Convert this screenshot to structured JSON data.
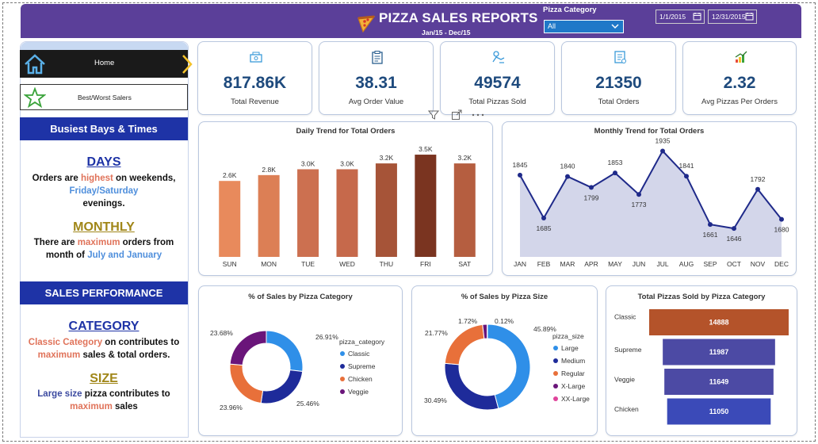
{
  "header": {
    "title": "PIZZA SALES REPORTS",
    "subtitle": "Jan/15  -  Dec/15",
    "category_label": "Pizza Category",
    "category_value": "All",
    "date_start": "1/1/2015",
    "date_end": "12/31/2015",
    "accent_color": "#5b3f99"
  },
  "nav": {
    "home_label": "Home",
    "best_worst_label": "Best/Worst Salers"
  },
  "sidebar": {
    "busiest_heading": "Busiest Bays & Times",
    "days_heading": "DAYS",
    "days_text": {
      "p1": "Orders are ",
      "hl1": "highest",
      "p2": " on weekends,",
      "hl2": "Friday/Saturday",
      "p3": "evenings."
    },
    "monthly_heading": "MONTHLY",
    "monthly_text": {
      "p1": "There are ",
      "hl1": "maximum",
      "p2": " orders from",
      "p3": "month of ",
      "hl2": "July and January"
    },
    "sales_heading": "SALES PERFORMANCE",
    "category_heading": "CATEGORY",
    "category_text": {
      "hl1": "Classic Category",
      "p1": " on contributes to",
      "hl2": "maximum",
      "p2": " sales & total orders."
    },
    "size_heading": "SIZE",
    "size_text": {
      "hl1": "Large size",
      "p1": " pizza contributes to",
      "hl2": "maximum",
      "p2": " sales"
    }
  },
  "kpis": [
    {
      "value": "817.86K",
      "label": "Total Revenue",
      "icon": "revenue-icon"
    },
    {
      "value": "38.31",
      "label": "Avg Order Value",
      "icon": "clipboard-icon"
    },
    {
      "value": "49574",
      "label": "Total Pizzas Sold",
      "icon": "pizza-delivery-icon"
    },
    {
      "value": "21350",
      "label": "Total Orders",
      "icon": "orders-icon"
    },
    {
      "value": "2.32",
      "label": "Avg Pizzas Per Orders",
      "icon": "growth-chart-icon"
    }
  ],
  "chart_data": [
    {
      "type": "bar",
      "title": "Daily Trend for Total Orders",
      "categories": [
        "SUN",
        "MON",
        "TUE",
        "WED",
        "THU",
        "FRI",
        "SAT"
      ],
      "values": [
        2.6,
        2.8,
        3.0,
        3.0,
        3.2,
        3.5,
        3.2
      ],
      "data_labels": [
        "2.6K",
        "2.8K",
        "3.0K",
        "3.0K",
        "3.2K",
        "3.5K",
        "3.2K"
      ],
      "colors": [
        "#e88a5c",
        "#dc7f55",
        "#cc7050",
        "#c6694b",
        "#a65438",
        "#7a3420",
        "#b55e40"
      ],
      "ylim": [
        0,
        3.8
      ]
    },
    {
      "type": "area",
      "title": "Monthly Trend for Total Orders",
      "categories": [
        "JAN",
        "FEB",
        "MAR",
        "APR",
        "MAY",
        "JUN",
        "JUL",
        "AUG",
        "SEP",
        "OCT",
        "NOV",
        "DEC"
      ],
      "values": [
        1845,
        1685,
        1840,
        1799,
        1853,
        1773,
        1935,
        1841,
        1661,
        1646,
        1792,
        1680
      ],
      "ylim": [
        1540,
        1960
      ],
      "line_color": "#1f2a8a",
      "fill_color": "#d3d6ea"
    },
    {
      "type": "pie",
      "title": "% of Sales by Pizza Category",
      "legend_title": "pizza_category",
      "labels": [
        "Classic",
        "Supreme",
        "Chicken",
        "Veggie"
      ],
      "values": [
        26.91,
        25.46,
        23.96,
        23.68
      ],
      "data_labels": [
        "26.91%",
        "25.46%",
        "23.96%",
        "23.68%"
      ],
      "colors": [
        "#2f8fe8",
        "#1e2b9a",
        "#e8703a",
        "#6a157a"
      ]
    },
    {
      "type": "pie",
      "title": "% of Sales by Pizza Size",
      "legend_title": "pizza_size",
      "labels": [
        "Large",
        "Medium",
        "Regular",
        "X-Large",
        "XX-Large"
      ],
      "values": [
        45.89,
        30.49,
        21.77,
        1.72,
        0.12
      ],
      "data_labels": [
        "45.89%",
        "30.49%",
        "21.77%",
        "1.72%",
        "0.12%"
      ],
      "colors": [
        "#2f8fe8",
        "#1e2b9a",
        "#e8703a",
        "#6a157a",
        "#e0449b"
      ]
    },
    {
      "type": "bar",
      "orientation": "horizontal",
      "title": "Total Pizzas Sold by Pizza Category",
      "categories": [
        "Classic",
        "Supreme",
        "Veggie",
        "Chicken"
      ],
      "values": [
        14888,
        11987,
        11649,
        11050
      ],
      "colors": [
        "#b4532a",
        "#4c4aa4",
        "#4c4aa4",
        "#3b4ab8"
      ]
    }
  ]
}
